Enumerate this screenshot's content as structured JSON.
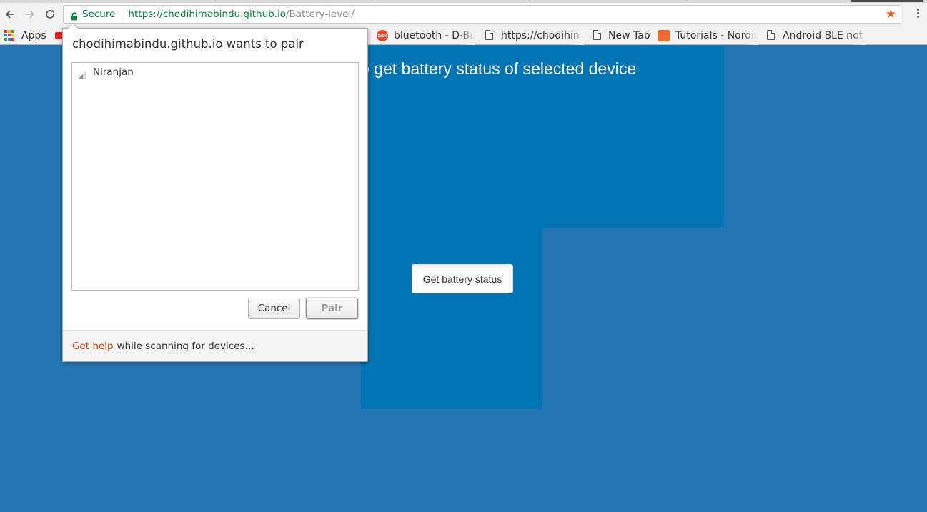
{
  "browser": {
    "omnibox": {
      "security_label": "Secure",
      "url_origin": "https://chodihimabindu.github.io",
      "url_path": "/Battery-level/"
    },
    "bookmarks": [
      {
        "label": "Apps",
        "icon": "apps-grid-icon"
      },
      {
        "label": "",
        "icon": "youtube-icon"
      },
      {
        "label": "bluetooth - D-Bu",
        "icon": "ask-icon"
      },
      {
        "label": "https://chodihin",
        "icon": "page-icon"
      },
      {
        "label": "New Tab",
        "icon": "page-icon"
      },
      {
        "label": "Tutorials - Nordic",
        "icon": "nordic-chat-icon"
      },
      {
        "label": "Android BLE not",
        "icon": "page-icon"
      }
    ]
  },
  "page": {
    "heading": "o get battery status of selected device",
    "battery_button": "Get battery status"
  },
  "dialog": {
    "title": "chodihimabindu.github.io wants to pair",
    "devices": [
      {
        "name": "Niranjan"
      }
    ],
    "cancel_label": "Cancel",
    "pair_label": "Pair",
    "help_link": "Get help",
    "help_text": "while scanning for devices…"
  },
  "colors": {
    "page_background": "#2475b3",
    "panel": "#0174b4",
    "secure_green": "#0b8043",
    "help_link": "#c2410c",
    "star": "#e8682a"
  }
}
